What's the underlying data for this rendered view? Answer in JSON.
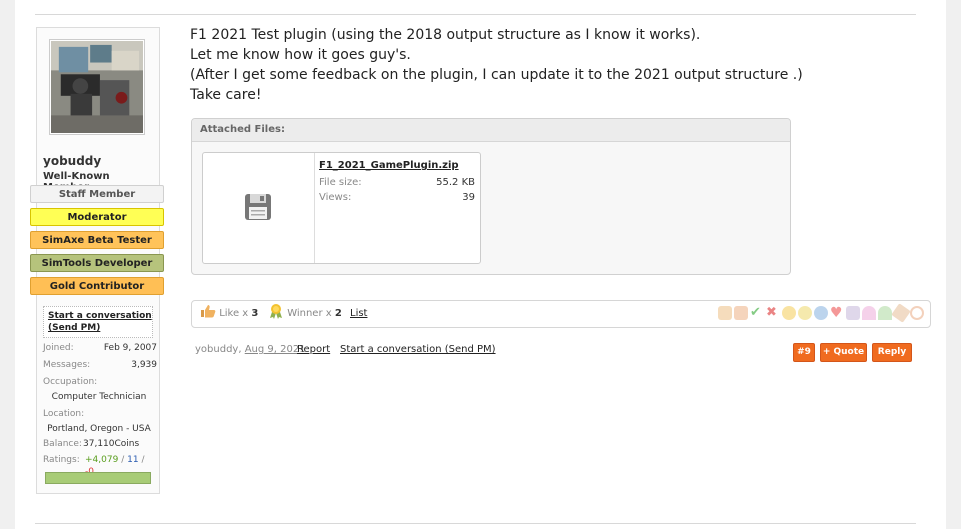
{
  "user": {
    "name": "yobuddy",
    "title": "Well-Known Member",
    "banners": [
      "Staff Member",
      "Moderator",
      "SimAxe Beta Tester",
      "SimTools Developer",
      "Gold Contributor"
    ],
    "conversation_link": "Start a conversation (Send PM)",
    "stats": {
      "joined_label": "Joined:",
      "joined": "Feb 9, 2007",
      "messages_label": "Messages:",
      "messages": "3,939",
      "occupation_label": "Occupation:",
      "occupation": "Computer Technician",
      "location_label": "Location:",
      "location": "Portland, Oregon - USA",
      "balance_label": "Balance:",
      "balance": "37,110Coins",
      "ratings_label": "Ratings:",
      "ratings_pos": "+4,079",
      "ratings_sep1": "/",
      "ratings_neu": "11",
      "ratings_sep2": "/",
      "ratings_neg": "-0"
    }
  },
  "message": {
    "lines": [
      "F1 2021 Test plugin (using the 2018 output structure as I know it works).",
      "Let me know how it goes guy's.",
      "(After I get some feedback on the plugin, I can update it to the 2021 output structure .)",
      "Take care!"
    ]
  },
  "attachments": {
    "header": "Attached Files:",
    "file": {
      "name": "F1_2021_GamePlugin.zip",
      "size_label": "File size:",
      "size": "55.2 KB",
      "views_label": "Views:",
      "views": "39"
    }
  },
  "likes": {
    "like_label": "Like x",
    "like_count": "3",
    "winner_label": "Winner x",
    "winner_count": "2",
    "list_label": "List"
  },
  "footer": {
    "author": "yobuddy,",
    "date": "Aug 9, 2021",
    "report": "Report",
    "conversation": "Start a conversation (Send PM)",
    "post_number": "#9",
    "quote": "+ Quote",
    "reply": "Reply"
  },
  "colors": {
    "accent": "#f06b1f",
    "moderator_banner": "#ffff55",
    "beta_banner": "#ffc35a",
    "developer_banner": "#b6c37c",
    "gold_banner": "#ffbf55",
    "rating_positive": "#5a9e1e"
  },
  "icons": [
    "like-icon",
    "winner-icon",
    "floppy-disk-icon",
    "rating-icons"
  ]
}
